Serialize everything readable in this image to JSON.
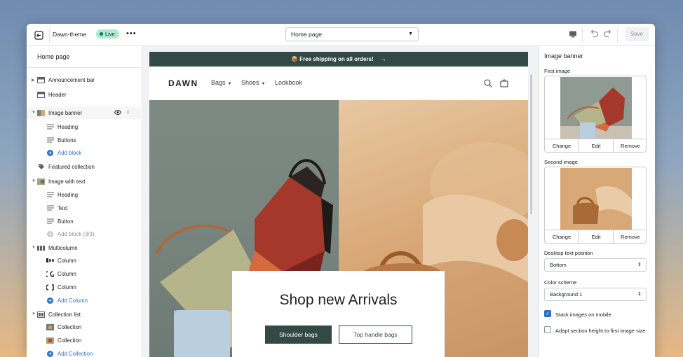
{
  "topbar": {
    "theme_name": "Dawn-theme",
    "live_badge": "Live",
    "page_select": "Home page",
    "save_label": "Save"
  },
  "sidebar": {
    "title": "Home page",
    "items": [
      {
        "label": "Announcement bar"
      },
      {
        "label": "Header"
      },
      {
        "label": "Image banner"
      },
      {
        "label": "Heading"
      },
      {
        "label": "Buttons"
      },
      {
        "label": "Add block"
      },
      {
        "label": "Featured collection"
      },
      {
        "label": "Image with text"
      },
      {
        "label": "Heading"
      },
      {
        "label": "Text"
      },
      {
        "label": "Button"
      },
      {
        "label": "Add block (3/3)"
      },
      {
        "label": "Multicolumn"
      },
      {
        "label": "Column"
      },
      {
        "label": "Column"
      },
      {
        "label": "Column"
      },
      {
        "label": "Add Column"
      },
      {
        "label": "Collection list"
      },
      {
        "label": "Collection"
      },
      {
        "label": "Collection"
      },
      {
        "label": "Add Collection"
      }
    ]
  },
  "preview": {
    "announcement": "Free shipping on all orders!",
    "announcement_arrow": "→",
    "logo": "DAWN",
    "nav": [
      "Bags",
      "Shoes",
      "Lookbook"
    ],
    "banner_heading": "Shop new Arrivals",
    "button_primary": "Shoulder bags",
    "button_secondary": "Top handle bags"
  },
  "settings": {
    "title": "Image banner",
    "first_image_label": "First image",
    "second_image_label": "Second image",
    "change": "Change",
    "edit": "Edit",
    "remove": "Remove",
    "text_position_label": "Desktop text position",
    "text_position_value": "Bottom",
    "color_scheme_label": "Color scheme",
    "color_scheme_value": "Background 1",
    "stack_images": "Stack images on mobile",
    "stack_images_checked": true,
    "adapt_height": "Adapt section height to first image size",
    "adapt_height_checked": false
  },
  "colors": {
    "brand_dark": "#334a44",
    "link_blue": "#2c6ecb",
    "live_green": "#aee9d1"
  }
}
